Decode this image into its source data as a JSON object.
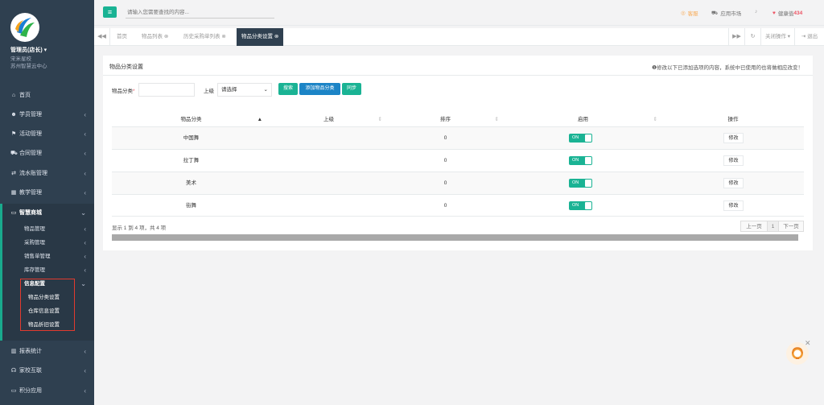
{
  "sidebar": {
    "user_name": "管理员(店长)",
    "user_org": "宋米星校",
    "user_center": "苏州智慧云中心",
    "items": [
      {
        "label": "首页",
        "icon": "home-icon"
      },
      {
        "label": "学员管理",
        "icon": "users-icon"
      },
      {
        "label": "活动管理",
        "icon": "flag-icon"
      },
      {
        "label": "合同管理",
        "icon": "cart-icon"
      },
      {
        "label": "流水账管理",
        "icon": "exchange-icon"
      },
      {
        "label": "教学管理",
        "icon": "bank-icon"
      },
      {
        "label": "智慧商城",
        "icon": "car-icon"
      },
      {
        "label": "报表统计",
        "icon": "chart-icon"
      },
      {
        "label": "家校互联",
        "icon": "link-icon"
      },
      {
        "label": "积分应用",
        "icon": "credit-card-icon"
      }
    ],
    "submenu": [
      "物品管理",
      "采购管理",
      "销售单管理",
      "库存管理",
      "信息配置"
    ],
    "submenu2": [
      "物品分类设置",
      "仓库信息设置",
      "物品折旧设置"
    ]
  },
  "topbar": {
    "search_placeholder": "请输入您需要查找的内容...",
    "service": "客服",
    "app_market": "应用市场",
    "health_label": "健康值",
    "health_value": "434"
  },
  "tabs": {
    "items": [
      "首页",
      "物品列表",
      "历史采购单列表",
      "物品分类设置"
    ],
    "close_ops": "关闭操作",
    "exit": "退出"
  },
  "panel": {
    "title": "物品分类设置",
    "note": "修改以下已添加选项的内容，系统中已使用的也将做相应改变！",
    "form": {
      "category_label": "物品分类",
      "required_mark": "*",
      "parent_label": "上级",
      "parent_value": "请选择",
      "search_btn": "搜索",
      "add_btn": "添加物品分类",
      "sync_btn": "同步"
    },
    "table": {
      "headers": [
        "物品分类",
        "上级",
        "排序",
        "启用",
        "操作"
      ],
      "rows": [
        {
          "name": "中国舞",
          "parent": "",
          "sort": "0",
          "enabled": "ON",
          "action": "修改"
        },
        {
          "name": "拉丁舞",
          "parent": "",
          "sort": "0",
          "enabled": "ON",
          "action": "修改"
        },
        {
          "name": "美术",
          "parent": "",
          "sort": "0",
          "enabled": "ON",
          "action": "修改"
        },
        {
          "name": "街舞",
          "parent": "",
          "sort": "0",
          "enabled": "ON",
          "action": "修改"
        }
      ]
    },
    "pagination": {
      "info": "显示 1 到 4 项，共 4 项",
      "prev": "上一页",
      "page": "1",
      "next": "下一页"
    }
  },
  "colors": {
    "accent": "#1ab394",
    "sidebar": "#2f4050",
    "highlight_box": "#e23b2e"
  }
}
